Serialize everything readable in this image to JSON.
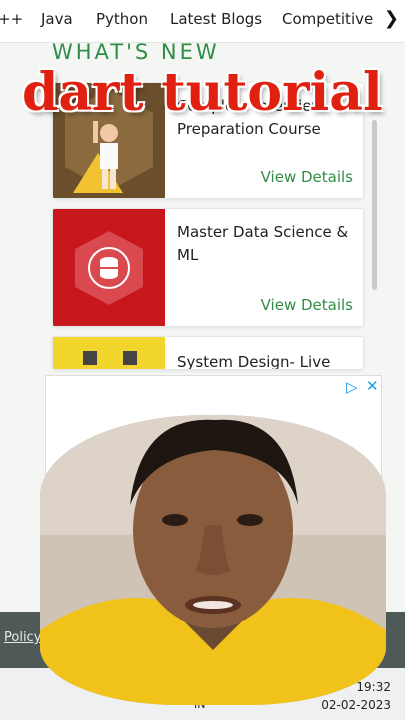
{
  "nav": {
    "items": [
      "++",
      "Java",
      "Python",
      "Latest Blogs",
      "Competitive"
    ],
    "chevron": "chevron-right-icon"
  },
  "section_heading": "WHAT'S NEW",
  "overlay_title": "dart tutorial",
  "cards": [
    {
      "title": "Complete Interview Preparation Course",
      "link": "View Details",
      "thumb_color": "#7a5a35"
    },
    {
      "title": "Master Data Science & ML",
      "link": "View Details",
      "thumb_color": "#c8161d"
    },
    {
      "title": "System Design- Live",
      "link": "",
      "thumb_color": "#f2d62e"
    }
  ],
  "ad": {
    "play_icon": "adchoices-icon",
    "close_icon": "close-icon"
  },
  "footer": {
    "policy": "Policy",
    "amp": "&"
  },
  "taskbar": {
    "lang": "IN",
    "time": "19:32",
    "date": "02-02-2023"
  },
  "colors": {
    "accent": "#2f8d46",
    "overlay": "#e02010",
    "footer": "#4f5a58"
  }
}
